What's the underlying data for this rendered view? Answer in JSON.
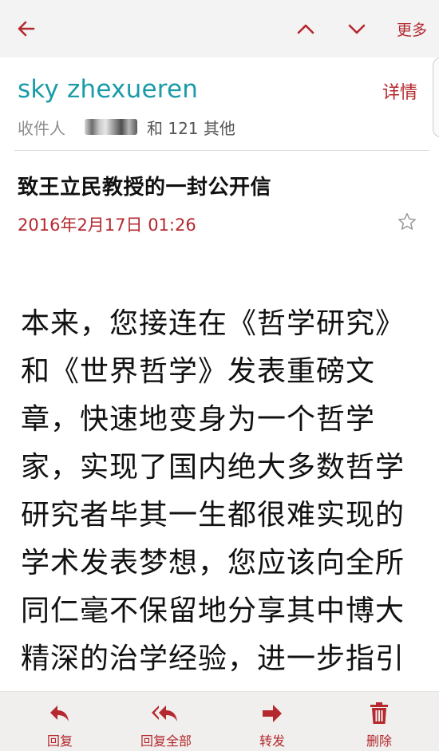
{
  "header": {
    "back_icon": "back-arrow-icon",
    "prev_icon": "chevron-up-icon",
    "next_icon": "chevron-down-icon",
    "more_label": "更多"
  },
  "email": {
    "sender": "sky zhexueren",
    "details_label": "详情",
    "recipients_label": "收件人",
    "recipients_more": "和 121 其他",
    "subject": "致王立民教授的一封公开信",
    "date": "2016年2月17日  01:26",
    "body": "本来，您接连在《哲学研究》和《世界哲学》发表重磅文章，快速地变身为一个哲学家，实现了国内绝大多数哲学研究者毕其一生都很难实现的学术发表梦想，您应该向全所同仁毫不保留地分享其中博大精深的治学经验，进一步指引我们在创新"
  },
  "toolbar": {
    "reply_label": "回复",
    "reply_all_label": "回复全部",
    "forward_label": "转发",
    "delete_label": "删除"
  },
  "colors": {
    "accent": "#b4282e",
    "sender": "#1a9ba7",
    "topbar_bg": "#f3f3f3",
    "bottombar_bg": "#f0efed"
  }
}
